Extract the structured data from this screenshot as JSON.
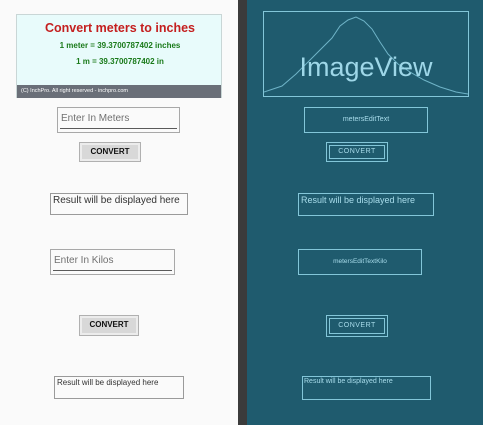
{
  "design": {
    "banner": {
      "title": "Convert meters to inches",
      "line1": "1 meter = 39.3700787402 inches",
      "line2": "1 m = 39.3700787402 in",
      "footer": "(C) InchPro. All right reserved - inchpro.com"
    },
    "meters_input": {
      "placeholder": "Enter In Meters"
    },
    "convert_button_1": "CONVERT",
    "result_1": "Result will be displayed here",
    "kilos_input": {
      "placeholder": "Enter In Kilos"
    },
    "convert_button_2": "CONVERT",
    "result_2": "Result will be displayed here"
  },
  "blueprint": {
    "imageview_label": "ImageView",
    "meters_edittext": "metersEditText",
    "convert_button_1": "CONVERT",
    "result_1": "Result will be displayed here",
    "kilos_edittext": "metersEditTextKilo",
    "convert_button_2": "CONVERT",
    "result_2": "Result will be displayed here"
  },
  "colors": {
    "banner_title": "#c41f1f",
    "banner_text": "#1a7a1a",
    "banner_bg": "#e8fbfb",
    "blueprint_bg": "#1f5b6e",
    "blueprint_line": "#83c6d9"
  }
}
